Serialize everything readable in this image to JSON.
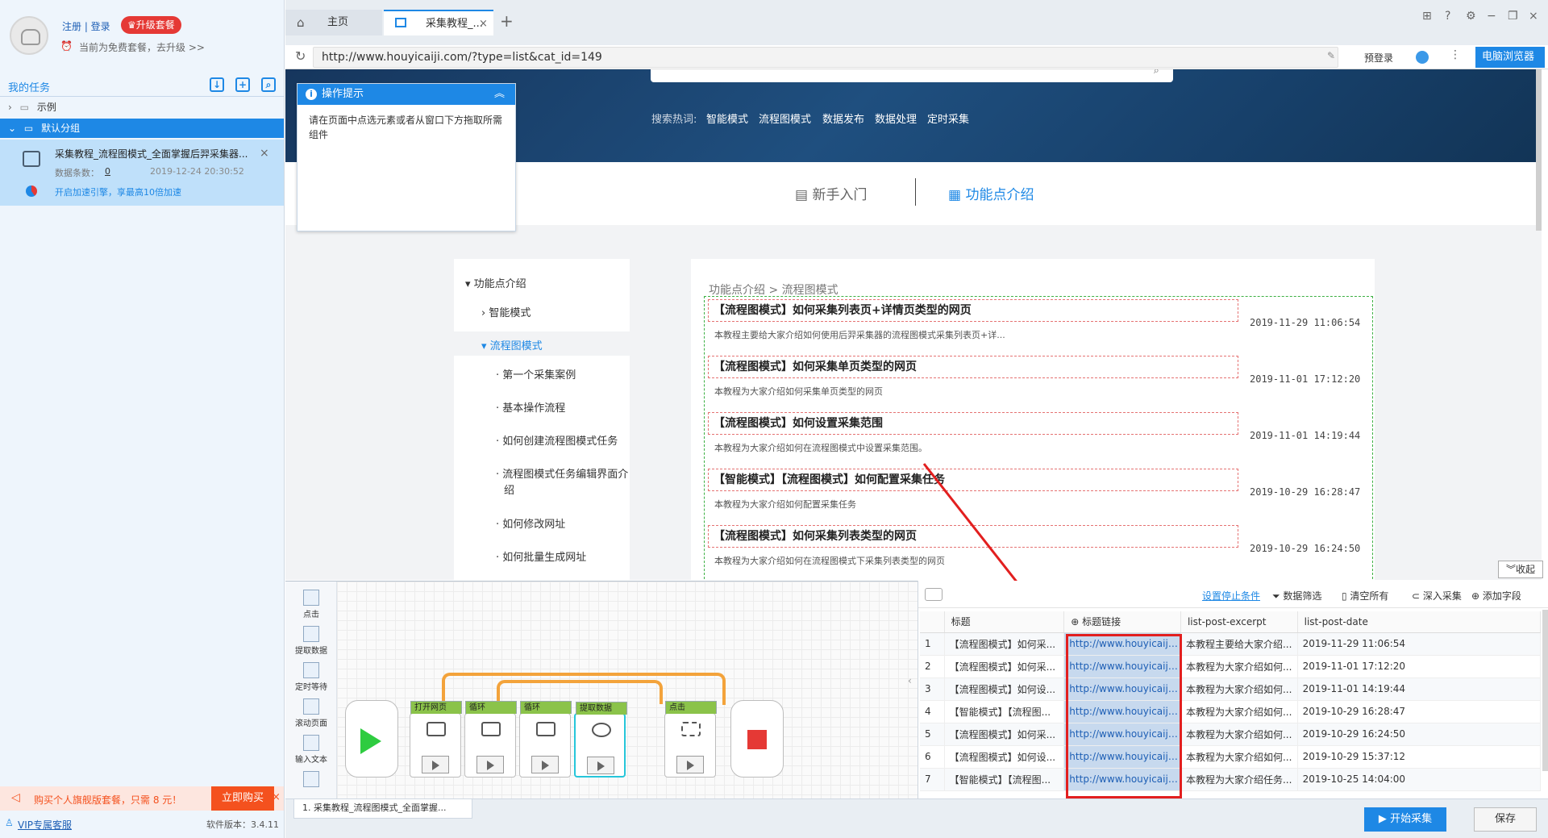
{
  "account": {
    "register_login": "注册 | 登录",
    "upgrade_label": "升级套餐",
    "plan_status": "当前为免费套餐，去升级 >>"
  },
  "sidebar": {
    "section_title": "我的任务",
    "tree": [
      {
        "label": "示例"
      },
      {
        "label": "默认分组"
      }
    ],
    "task": {
      "title": "采集教程_流程图模式_全面掌握后羿采集器...",
      "count_label": "数据条数：",
      "count": "0",
      "datetime": "2019-12-24 20:30:52",
      "boost_text": "开启加速引擎，享最高10倍加速"
    },
    "promo_text": "购买个人旗舰版套餐，只需 8 元！",
    "buy_label": "立即购买",
    "vip_label": "VIP专属客服",
    "version": "软件版本：3.4.11"
  },
  "browser": {
    "tabs": [
      {
        "label": "主页"
      },
      {
        "label": "采集教程_..."
      }
    ],
    "url": "http://www.houyicaiji.com/?type=list&cat_id=149",
    "prelogin": "预登录",
    "browser_button": "电脑浏览器"
  },
  "page": {
    "hot_label": "搜索热词:",
    "hot_words": [
      "智能模式",
      "流程图模式",
      "数据发布",
      "数据处理",
      "定时采集"
    ],
    "nav": [
      {
        "label": "新手入门"
      },
      {
        "label": "功能点介绍"
      }
    ],
    "menu": {
      "root": "功能点介绍",
      "smart": "智能模式",
      "flow": "流程图模式",
      "items": [
        "第一个采集案例",
        "基本操作流程",
        "如何创建流程图模式任务",
        "流程图模式任务编辑界面介",
        "绍",
        "如何修改网址",
        "如何批量生成网址"
      ]
    },
    "breadcrumb": "功能点介绍 > 流程图模式",
    "articles": [
      {
        "title": "【流程图模式】如何采集列表页+详情页类型的网页",
        "date": "2019-11-29 11:06:54",
        "excerpt": "本教程主要给大家介绍如何使用后羿采集器的流程图模式采集列表页+详..."
      },
      {
        "title": "【流程图模式】如何采集单页类型的网页",
        "date": "2019-11-01 17:12:20",
        "excerpt": "本教程为大家介绍如何采集单页类型的网页"
      },
      {
        "title": "【流程图模式】如何设置采集范围",
        "date": "2019-11-01 14:19:44",
        "excerpt": "本教程为大家介绍如何在流程图模式中设置采集范围。"
      },
      {
        "title": "【智能模式】【流程图模式】如何配置采集任务",
        "date": "2019-10-29 16:28:47",
        "excerpt": "本教程为大家介绍如何配置采集任务"
      },
      {
        "title": "【流程图模式】如何采集列表类型的网页",
        "date": "2019-10-29 16:24:50",
        "excerpt": "本教程为大家介绍如何在流程图模式下采集列表类型的网页"
      }
    ],
    "hint_title": "操作提示",
    "hint_text": "请在页面中点选元素或者从窗口下方拖取所需组件",
    "collapse": "收起"
  },
  "tools": [
    "点击",
    "提取数据",
    "定时等待",
    "滚动页面",
    "输入文本"
  ],
  "flow_nodes": [
    "打开网页",
    "循环",
    "循环",
    "提取数据",
    "点击"
  ],
  "data_panel": {
    "stop_condition": "设置停止条件",
    "filter": "数据筛选",
    "clear": "清空所有",
    "deep": "深入采集",
    "add_field": "添加字段",
    "columns": [
      "标题",
      "标题链接",
      "list-post-excerpt",
      "list-post-date"
    ],
    "rows": [
      [
        "1",
        "【流程图模式】如何采...",
        "http://www.houyicaiji.c...",
        "本教程主要给大家介绍...",
        "2019-11-29 11:06:54"
      ],
      [
        "2",
        "【流程图模式】如何采...",
        "http://www.houyicaiji.c...",
        "本教程为大家介绍如何...",
        "2019-11-01 17:12:20"
      ],
      [
        "3",
        "【流程图模式】如何设...",
        "http://www.houyicaiji.c...",
        "本教程为大家介绍如何...",
        "2019-11-01 14:19:44"
      ],
      [
        "4",
        "【智能模式】【流程图...",
        "http://www.houyicaiji.c...",
        "本教程为大家介绍如何...",
        "2019-10-29 16:28:47"
      ],
      [
        "5",
        "【流程图模式】如何采...",
        "http://www.houyicaiji.c...",
        "本教程为大家介绍如何...",
        "2019-10-29 16:24:50"
      ],
      [
        "6",
        "【流程图模式】如何设...",
        "http://www.houyicaiji.c...",
        "本教程为大家介绍如何...",
        "2019-10-29 15:37:12"
      ],
      [
        "7",
        "【智能模式】【流程图...",
        "http://www.houyicaiji.c...",
        "本教程为大家介绍任务...",
        "2019-10-25 14:04:00"
      ]
    ]
  },
  "status": {
    "task_tab": "1. 采集教程_流程图模式_全面掌握...",
    "start": "开始采集",
    "save": "保存"
  },
  "colors": {
    "accent": "#1e88e5",
    "danger": "#e53935",
    "banner": "#1f4f7f"
  }
}
